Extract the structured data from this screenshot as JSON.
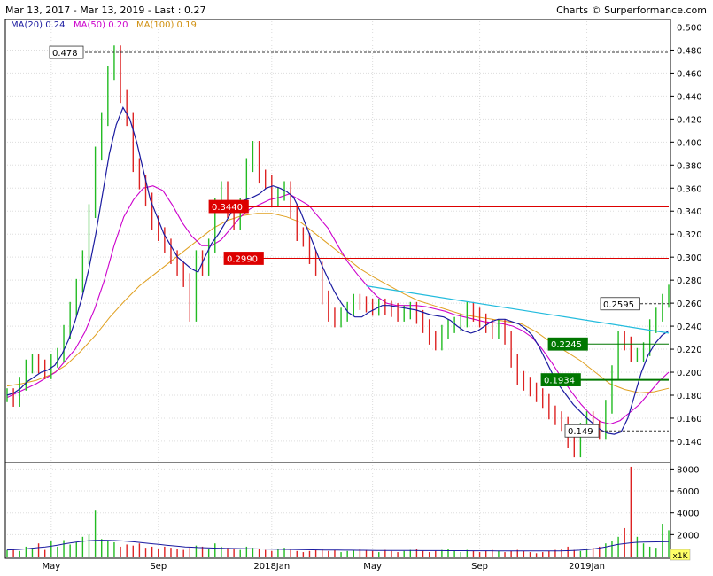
{
  "header": {
    "left": "Mar 13, 2017 - Mar 13, 2019 - Last : 0.27",
    "right": "Charts © Surperformance.com"
  },
  "legend": [
    {
      "label": "MA(20)",
      "value": "0.24",
      "color": "#1a1aa0"
    },
    {
      "label": "MA(50)",
      "value": "0.20",
      "color": "#cc00cc"
    },
    {
      "label": "MA(100)",
      "value": "0.19",
      "color": "#e0a020"
    }
  ],
  "chart_data": {
    "type": "line",
    "price_axis": {
      "ticks": [
        0.14,
        0.16,
        0.18,
        0.2,
        0.22,
        0.24,
        0.26,
        0.28,
        0.3,
        0.32,
        0.34,
        0.36,
        0.38,
        0.4,
        0.42,
        0.44,
        0.46,
        0.48,
        0.5
      ],
      "labels": [
        "0.140",
        "0.160",
        "0.180",
        "0.200",
        "0.220",
        "0.240",
        "0.260",
        "0.280",
        "0.300",
        "0.320",
        "0.340",
        "0.360",
        "0.380",
        "0.400",
        "0.420",
        "0.440",
        "0.460",
        "0.480",
        "0.500"
      ]
    },
    "volume_axis": {
      "ticks": [
        2000,
        4000,
        6000,
        8000
      ],
      "labels": [
        "2000",
        "4000",
        "6000",
        "8000"
      ],
      "unit": "x1K"
    },
    "x_axis": {
      "labels": [
        "May",
        "Sep",
        "2018Jan",
        "May",
        "Sep",
        "2019Jan"
      ],
      "positions_index": [
        7,
        24,
        42,
        58,
        75,
        92
      ]
    },
    "price_series": {
      "name": "",
      "color": "#22bb22",
      "values": [
        0.18,
        0.176,
        0.19,
        0.205,
        0.21,
        0.205,
        0.2,
        0.21,
        0.215,
        0.235,
        0.255,
        0.275,
        0.3,
        0.34,
        0.39,
        0.42,
        0.46,
        0.478,
        0.44,
        0.42,
        0.38,
        0.365,
        0.35,
        0.33,
        0.32,
        0.31,
        0.3,
        0.29,
        0.28,
        0.25,
        0.3,
        0.29,
        0.31,
        0.345,
        0.36,
        0.34,
        0.33,
        0.345,
        0.38,
        0.395,
        0.37,
        0.365,
        0.35,
        0.355,
        0.36,
        0.34,
        0.32,
        0.315,
        0.3,
        0.29,
        0.265,
        0.25,
        0.245,
        0.25,
        0.255,
        0.262,
        0.26,
        0.258,
        0.255,
        0.258,
        0.256,
        0.254,
        0.25,
        0.252,
        0.255,
        0.248,
        0.24,
        0.23,
        0.225,
        0.235,
        0.24,
        0.242,
        0.245,
        0.255,
        0.25,
        0.245,
        0.24,
        0.235,
        0.24,
        0.23,
        0.21,
        0.195,
        0.19,
        0.185,
        0.18,
        0.175,
        0.165,
        0.16,
        0.155,
        0.14,
        0.132,
        0.15,
        0.16,
        0.152,
        0.148,
        0.17,
        0.2,
        0.23,
        0.225,
        0.215,
        0.215,
        0.22,
        0.24,
        0.25,
        0.262,
        0.27
      ]
    },
    "ma20": {
      "name": "MA(20)",
      "color": "#1a1aa0",
      "values": [
        0.18,
        0.182,
        0.186,
        0.192,
        0.196,
        0.2,
        0.202,
        0.206,
        0.215,
        0.228,
        0.245,
        0.265,
        0.29,
        0.32,
        0.355,
        0.39,
        0.415,
        0.43,
        0.42,
        0.4,
        0.375,
        0.35,
        0.335,
        0.32,
        0.31,
        0.3,
        0.295,
        0.29,
        0.287,
        0.3,
        0.312,
        0.32,
        0.33,
        0.34,
        0.348,
        0.35,
        0.352,
        0.355,
        0.36,
        0.362,
        0.36,
        0.357,
        0.352,
        0.34,
        0.325,
        0.31,
        0.295,
        0.282,
        0.27,
        0.26,
        0.252,
        0.248,
        0.248,
        0.252,
        0.255,
        0.258,
        0.258,
        0.257,
        0.256,
        0.255,
        0.254,
        0.252,
        0.25,
        0.249,
        0.248,
        0.245,
        0.24,
        0.236,
        0.234,
        0.236,
        0.24,
        0.244,
        0.246,
        0.246,
        0.244,
        0.242,
        0.238,
        0.232,
        0.222,
        0.21,
        0.198,
        0.188,
        0.18,
        0.172,
        0.166,
        0.16,
        0.155,
        0.15,
        0.147,
        0.146,
        0.148,
        0.16,
        0.18,
        0.2,
        0.215,
        0.225,
        0.232,
        0.236
      ]
    },
    "ma50": {
      "name": "MA(50)",
      "color": "#cc00cc",
      "values": [
        0.178,
        0.182,
        0.186,
        0.19,
        0.195,
        0.2,
        0.21,
        0.22,
        0.235,
        0.255,
        0.28,
        0.31,
        0.335,
        0.35,
        0.36,
        0.362,
        0.358,
        0.345,
        0.33,
        0.318,
        0.31,
        0.31,
        0.315,
        0.325,
        0.335,
        0.342,
        0.346,
        0.35,
        0.352,
        0.355,
        0.35,
        0.345,
        0.335,
        0.325,
        0.31,
        0.296,
        0.285,
        0.275,
        0.266,
        0.26,
        0.258,
        0.258,
        0.258,
        0.257,
        0.255,
        0.253,
        0.25,
        0.248,
        0.246,
        0.244,
        0.243,
        0.242,
        0.24,
        0.236,
        0.23,
        0.22,
        0.208,
        0.195,
        0.183,
        0.172,
        0.163,
        0.157,
        0.155,
        0.158,
        0.165,
        0.172,
        0.182,
        0.192,
        0.2
      ]
    },
    "ma100": {
      "name": "MA(100)",
      "color": "#e0a020",
      "values": [
        0.188,
        0.19,
        0.193,
        0.198,
        0.206,
        0.218,
        0.232,
        0.248,
        0.262,
        0.275,
        0.285,
        0.295,
        0.305,
        0.315,
        0.325,
        0.332,
        0.336,
        0.338,
        0.338,
        0.335,
        0.33,
        0.32,
        0.31,
        0.3,
        0.29,
        0.282,
        0.275,
        0.268,
        0.262,
        0.258,
        0.254,
        0.25,
        0.248,
        0.246,
        0.244,
        0.242,
        0.235,
        0.226,
        0.218,
        0.21,
        0.2,
        0.19,
        0.185,
        0.182,
        0.183,
        0.186
      ]
    },
    "resistance_lines": [
      {
        "label": "0.478",
        "value": 0.478,
        "color": "#333333",
        "style": "dashed",
        "label_bg": "#ffffff",
        "label_fg": "#000000"
      },
      {
        "label": "0.3440",
        "value": 0.344,
        "color": "#dd0000",
        "style": "solid-thick",
        "label_bg": "#dd0000",
        "label_fg": "#ffffff"
      },
      {
        "label": "0.2990",
        "value": 0.299,
        "color": "#dd0000",
        "style": "solid",
        "label_bg": "#dd0000",
        "label_fg": "#ffffff"
      },
      {
        "label": "0.2595",
        "value": 0.2595,
        "color": "#333333",
        "style": "dashed",
        "label_bg": "#ffffff",
        "label_fg": "#000000"
      },
      {
        "label": "0.2245",
        "value": 0.2245,
        "color": "#007700",
        "style": "solid",
        "label_bg": "#007700",
        "label_fg": "#ffffff"
      },
      {
        "label": "0.1934",
        "value": 0.1934,
        "color": "#007700",
        "style": "solid-thick",
        "label_bg": "#007700",
        "label_fg": "#ffffff"
      },
      {
        "label": "0.149",
        "value": 0.149,
        "color": "#333333",
        "style": "dashed",
        "label_bg": "#ffffff",
        "label_fg": "#000000"
      }
    ],
    "trendline": {
      "color": "#22bbdd",
      "from": {
        "index": 57,
        "value": 0.275
      },
      "to": {
        "index": 105,
        "value": 0.234
      }
    },
    "volume_series": {
      "color": "#22bb22",
      "values": [
        600,
        700,
        500,
        900,
        800,
        1200,
        600,
        1400,
        900,
        1500,
        1100,
        1300,
        1800,
        2000,
        4200,
        1600,
        1400,
        1300,
        900,
        1100,
        1000,
        1200,
        800,
        900,
        700,
        900,
        800,
        700,
        600,
        800,
        1000,
        900,
        700,
        1200,
        900,
        800,
        700,
        600,
        900,
        800,
        700,
        600,
        500,
        700,
        800,
        600,
        500,
        400,
        500,
        600,
        700,
        500,
        600,
        400,
        500,
        600,
        700,
        600,
        500,
        400,
        600,
        500,
        400,
        500,
        600,
        700,
        500,
        400,
        500,
        600,
        700,
        500,
        400,
        600,
        500,
        400,
        500,
        600,
        500,
        400,
        500,
        600,
        500,
        400,
        300,
        400,
        500,
        600,
        700,
        900,
        600,
        500,
        700,
        800,
        900,
        1200,
        1400,
        1800,
        2600,
        8200,
        1800,
        1200,
        900,
        800,
        3000,
        2400
      ]
    },
    "volume_ma": {
      "color": "#1a1aa0",
      "values": [
        600,
        620,
        650,
        700,
        760,
        820,
        880,
        950,
        1050,
        1150,
        1250,
        1330,
        1400,
        1450,
        1480,
        1490,
        1480,
        1460,
        1430,
        1390,
        1340,
        1280,
        1220,
        1160,
        1100,
        1040,
        980,
        930,
        880,
        850,
        820,
        800,
        780,
        760,
        750,
        740,
        730,
        720,
        710,
        700,
        690,
        680,
        670,
        660,
        650,
        640,
        630,
        620,
        610,
        600,
        595,
        590,
        585,
        580,
        575,
        570,
        565,
        560,
        555,
        550,
        548,
        546,
        544,
        542,
        540,
        538,
        536,
        534,
        532,
        530,
        528,
        526,
        524,
        522,
        520,
        518,
        516,
        514,
        512,
        510,
        508,
        506,
        504,
        502,
        500,
        500,
        505,
        515,
        530,
        550,
        580,
        620,
        680,
        760,
        860,
        980,
        1100,
        1180,
        1250,
        1300,
        1320,
        1330,
        1340,
        1350,
        1360
      ]
    }
  }
}
